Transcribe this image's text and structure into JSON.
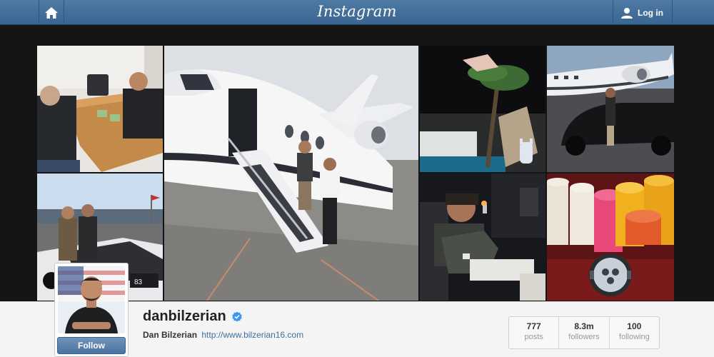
{
  "header": {
    "brand": "Instagram",
    "login_label": "Log in",
    "home_icon": "home-icon",
    "user_icon": "user-icon",
    "colors": {
      "bar": "#3b6592",
      "text": "#ffffff"
    }
  },
  "grid": {
    "photos": [
      "photo-poker-table",
      "photo-jet-stairs",
      "photo-pool-flip",
      "photo-jet-car",
      "photo-race-car",
      "photo-cabin-lighter",
      "photo-poker-chips-watch"
    ]
  },
  "profile": {
    "username": "danbilzerian",
    "verified_icon": "verified-badge-icon",
    "full_name": "Dan Bilzerian",
    "website": "http://www.bilzerian16.com",
    "follow_label": "Follow",
    "accent": "#4b739f"
  },
  "stats": [
    {
      "value": "777",
      "label": "posts"
    },
    {
      "value": "8.3m",
      "label": "followers"
    },
    {
      "value": "100",
      "label": "following"
    }
  ]
}
